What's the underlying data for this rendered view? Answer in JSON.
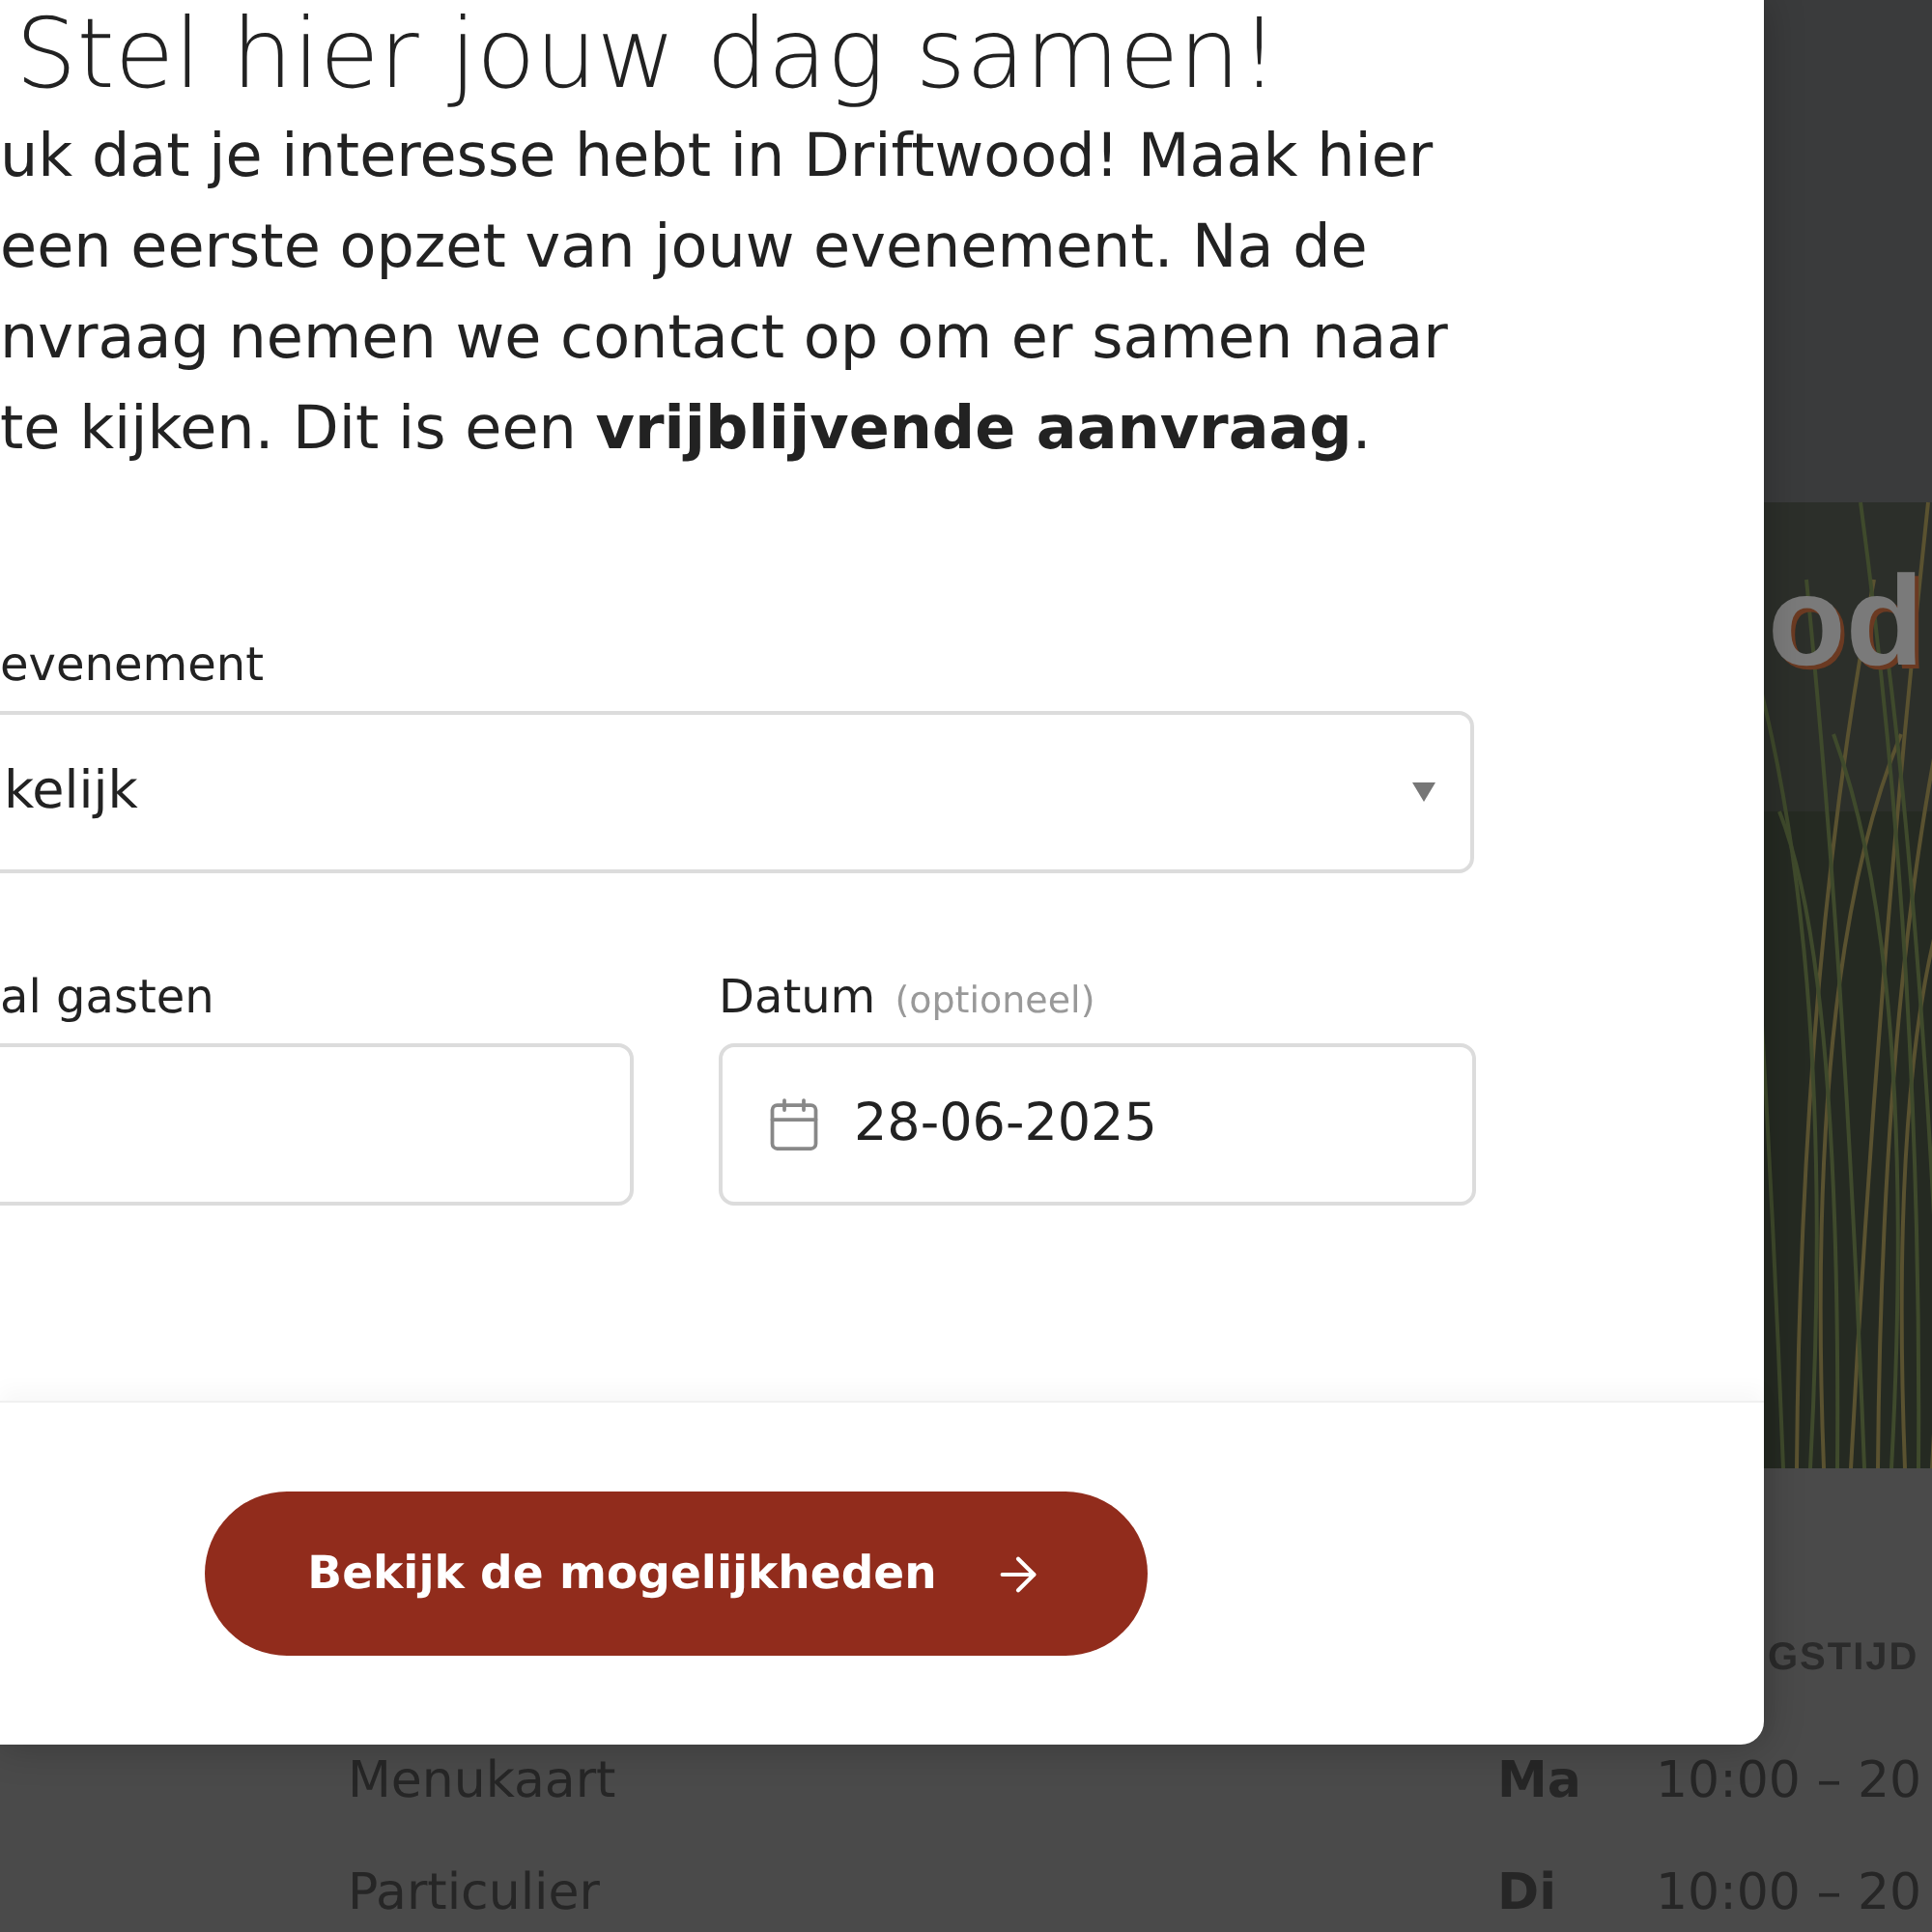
{
  "page": {
    "hero": {
      "title": "od"
    },
    "hours": {
      "heading": "GSTIJD",
      "rows": [
        {
          "item": "Menukaart",
          "day": "Ma",
          "time": "10:00 – 20"
        },
        {
          "item": "Particulier",
          "day": "Di",
          "time": "10:00 – 20"
        }
      ]
    }
  },
  "dialog": {
    "title": "Stel hier jouw dag samen!",
    "intro_lines": [
      "uk dat je interesse hebt in Driftwood! Maak hier",
      "een eerste opzet van jouw evenement. Na de",
      "nvraag nemen we contact op om er samen naar",
      "te kijken. Dit is een **vrijblijvende aanvraag**."
    ],
    "field_rows": [
      [
        {
          "kind": "select",
          "label": "evenement",
          "value": "kelijk"
        }
      ],
      [
        {
          "kind": "text",
          "label": "al gasten"
        },
        {
          "kind": "date",
          "label": "Datum",
          "hint": "(optioneel)",
          "value": "28-06-2025"
        }
      ]
    ],
    "submit": {
      "label": "Bekijk de mogelijkheden"
    }
  }
}
